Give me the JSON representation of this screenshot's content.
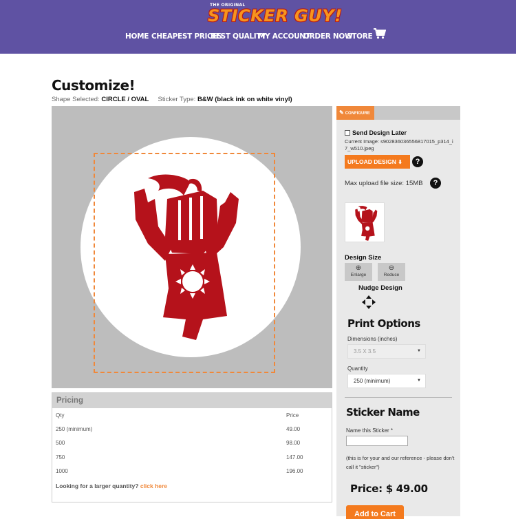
{
  "header": {
    "logo_small": "THE ORIGINAL",
    "logo_main": "STICKER GUY!",
    "nav": [
      "HOME",
      "CHEAPEST PRICES",
      "BEST QUALITY",
      "MY ACCOUNT",
      "ORDER NOW",
      "STORE"
    ],
    "cart_icon": "shopping-cart-icon"
  },
  "page": {
    "title": "Customize!",
    "shape_label": "Shape Selected:",
    "shape_value": "CIRCLE / OVAL",
    "type_label": "Sticker Type:",
    "type_value": "B&W (black ink on white vinyl)"
  },
  "pricing": {
    "heading": "Pricing",
    "col_qty": "Qty",
    "col_price": "Price",
    "rows": [
      {
        "qty": "250 (minimum)",
        "price": "49.00"
      },
      {
        "qty": "500",
        "price": "98.00"
      },
      {
        "qty": "750",
        "price": "147.00"
      },
      {
        "qty": "1000",
        "price": "196.00"
      }
    ],
    "larger_text": "Looking for a larger quantity?",
    "larger_link": "click here"
  },
  "panel": {
    "configure_tab": "CONFIGURE",
    "send_later": "Send Design Later",
    "current_image": "Current Image: s902836036556817015_p314_i7_w510.jpeg",
    "upload_button": "UPLOAD DESIGN",
    "max_upload": "Max upload file size: 15MB",
    "design_size": "Design Size",
    "enlarge": "Enlarge",
    "reduce": "Reduce",
    "nudge": "Nudge Design",
    "print_options": "Print Options",
    "dimensions_label": "Dimensions (inches)",
    "dimensions_value": "3.5 X 3.5",
    "quantity_label": "Quantity",
    "quantity_value": "250 (minimum)",
    "sticker_name": "Sticker Name",
    "name_label": "Name this Sticker *",
    "name_value": "",
    "name_note": "(this is for your and our reference - please don't call it \"sticker\")",
    "price": "Price: $ 49.00",
    "add_to_cart": "Add to Cart"
  },
  "colors": {
    "header_bg": "#5f52a3",
    "accent": "#f47a1e",
    "art_red": "#b5121b",
    "canvas_bg": "#bdbdbd"
  }
}
